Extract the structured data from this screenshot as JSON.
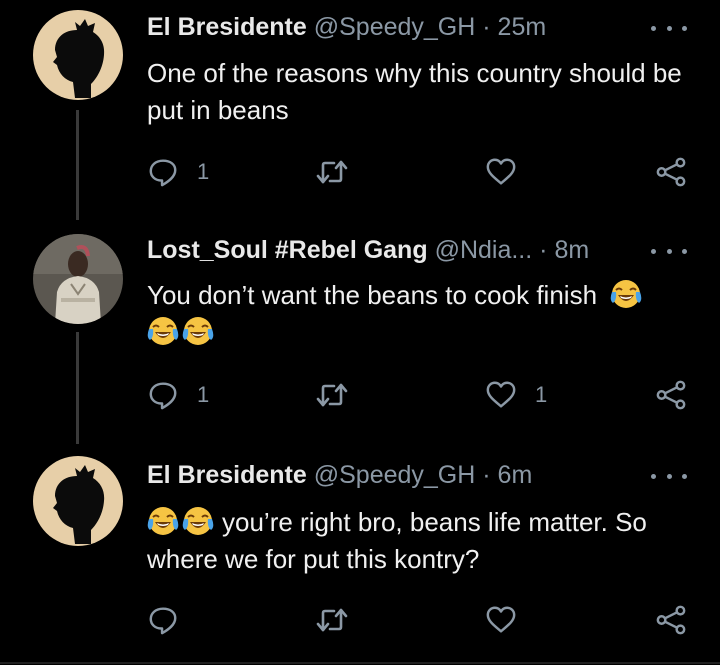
{
  "tweets": [
    {
      "name": "El Bresidente",
      "handle": "@Speedy_GH",
      "time": "25m",
      "text": "One of the reasons why this country should be put in beans",
      "replies": "1",
      "retweets": "",
      "likes": ""
    },
    {
      "name": "Lost_Soul #Rebel Gang",
      "handle": "@Ndia...",
      "time": "8m",
      "text": "You don’t want the beans to cook finish",
      "replies": "1",
      "retweets": "",
      "likes": "1"
    },
    {
      "name": "El Bresidente",
      "handle": "@Speedy_GH",
      "time": "6m",
      "text_line1": "you’re right bro, beans life matter. So",
      "text_line2": "where we for put this kontry?",
      "replies": "",
      "retweets": "",
      "likes": ""
    }
  ],
  "separator": "·",
  "icons": {
    "reply": "reply-icon",
    "retweet": "retweet-icon",
    "like": "heart-icon",
    "share": "share-icon",
    "emoji": "face-with-tears-of-joy"
  },
  "colors": {
    "background": "#000000",
    "secondary_text": "#8b98a5",
    "thread_line": "#3a3a3a",
    "avatar_bg": "#e7cfa8"
  }
}
